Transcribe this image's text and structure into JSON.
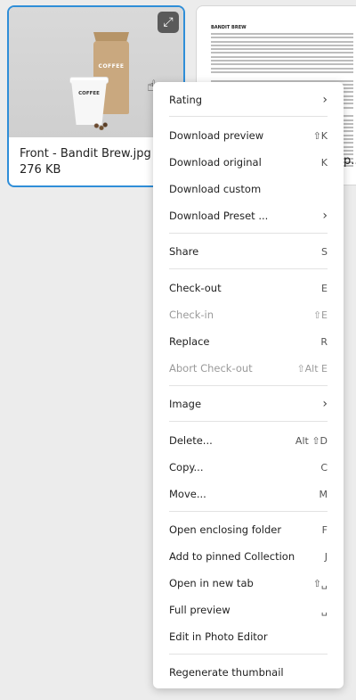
{
  "assets": [
    {
      "title": "Front - Bandit Brew.jpg",
      "size": "276 KB",
      "bag_label": "COFFEE",
      "cup_label": "COFFEE"
    },
    {
      "title_fragment": "p...",
      "doc_heading": "BANDIT BREW"
    }
  ],
  "menu": {
    "items": [
      {
        "label": "Rating",
        "shortcut": "›"
      },
      {
        "label": "Download preview",
        "shortcut": "⇧K"
      },
      {
        "label": "Download original",
        "shortcut": "K"
      },
      {
        "label": "Download custom",
        "shortcut": ""
      },
      {
        "label": "Download Preset ...",
        "shortcut": "›"
      },
      {
        "label": "Share",
        "shortcut": "S"
      },
      {
        "label": "Check-out",
        "shortcut": "E"
      },
      {
        "label": "Check-in",
        "shortcut": "⇧E"
      },
      {
        "label": "Replace",
        "shortcut": "R"
      },
      {
        "label": "Abort Check-out",
        "shortcut": "⇧Alt E"
      },
      {
        "label": "Image",
        "shortcut": "›"
      },
      {
        "label": "Delete...",
        "shortcut": "Alt ⇧D"
      },
      {
        "label": "Copy...",
        "shortcut": "C"
      },
      {
        "label": "Move...",
        "shortcut": "M"
      },
      {
        "label": "Open enclosing folder",
        "shortcut": "F"
      },
      {
        "label": "Add to pinned Collection",
        "shortcut": "J"
      },
      {
        "label": "Open in new tab",
        "shortcut": "⇧␣"
      },
      {
        "label": "Full preview",
        "shortcut": "␣"
      },
      {
        "label": "Edit in Photo Editor",
        "shortcut": ""
      },
      {
        "label": "Regenerate thumbnail",
        "shortcut": ""
      }
    ]
  }
}
